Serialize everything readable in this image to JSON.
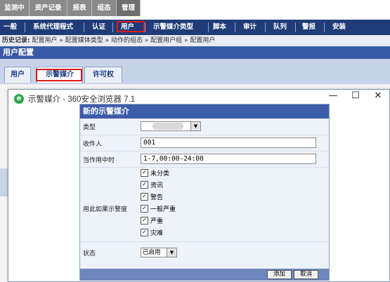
{
  "top_nav": {
    "items": [
      {
        "label": "监测中"
      },
      {
        "label": "资产记录"
      },
      {
        "label": "报表"
      },
      {
        "label": "组态"
      },
      {
        "label": "管理"
      }
    ]
  },
  "sub_nav": {
    "items": [
      {
        "label": "一般"
      },
      {
        "label": "系统代理程式"
      },
      {
        "label": "认证"
      },
      {
        "label": "用户"
      },
      {
        "label": "示警媒介类型"
      },
      {
        "label": "脚本"
      },
      {
        "label": "审计"
      },
      {
        "label": "队列"
      },
      {
        "label": "警报"
      },
      {
        "label": "安装"
      }
    ]
  },
  "breadcrumb": {
    "label": "历史记录:",
    "path": "配置用户 » 配置媒体类型 » 动作的组态 » 配置用户组 » 配置用户"
  },
  "page_title": "用户配置",
  "tabs": [
    {
      "label": "用户"
    },
    {
      "label": "示警媒介"
    },
    {
      "label": "许可权"
    }
  ],
  "browser": {
    "title": "示警媒介 - 360安全浏览器 7.1",
    "logo_letter": "e",
    "minimize": "—",
    "maximize": "☐",
    "close": "✕"
  },
  "dialog": {
    "title": "新的示警媒介",
    "type_label": "类型",
    "recipient_label": "收件人",
    "recipient_value": "001",
    "when_active_label": "当作用中时",
    "when_active_value": "1-7,00:00-24:00",
    "severity_label": "用此如果示警度",
    "severities": [
      {
        "label": "未分类",
        "checked": true
      },
      {
        "label": "资讯",
        "checked": true
      },
      {
        "label": "警告",
        "checked": true
      },
      {
        "label": "一般严重",
        "checked": true
      },
      {
        "label": "严重",
        "checked": true
      },
      {
        "label": "灾难",
        "checked": true
      }
    ],
    "status_label": "状态",
    "status_value": "已启用",
    "add_button": "添加",
    "cancel_button": "取消"
  },
  "colors": {
    "nav_blue": "#1f3c78",
    "title_blue": "#3b5aa5",
    "highlight_red": "#e01818"
  }
}
